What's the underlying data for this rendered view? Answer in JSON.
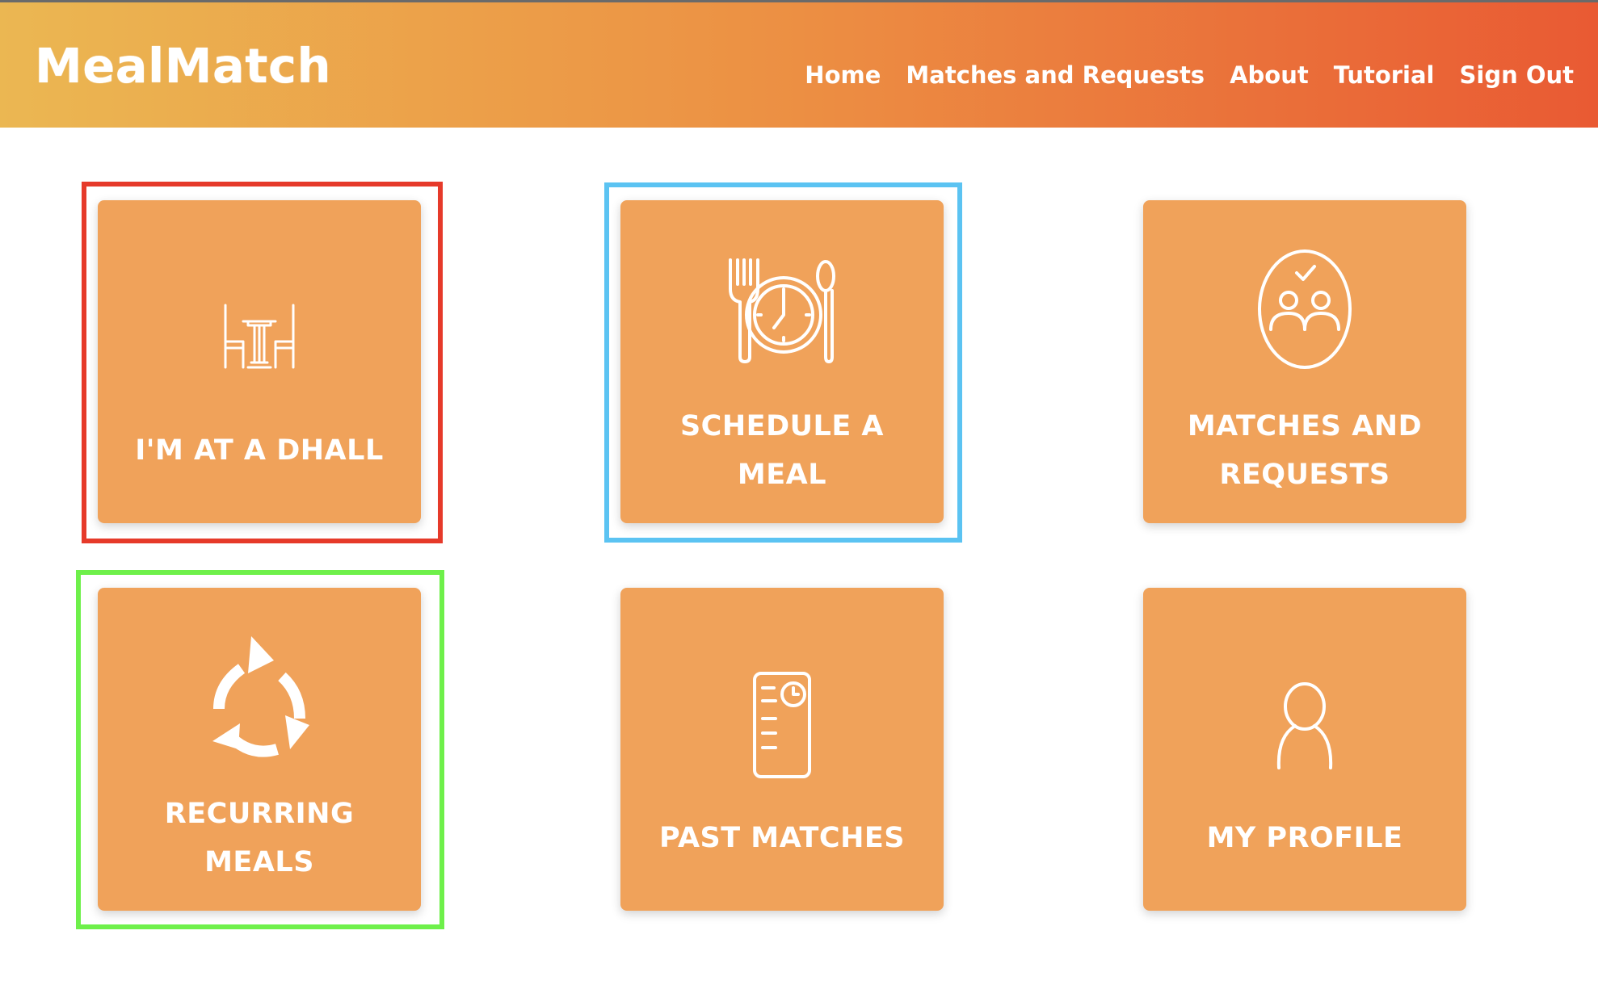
{
  "header": {
    "brand": "MealMatch",
    "nav": [
      "Home",
      "Matches and Requests",
      "About",
      "Tutorial",
      "Sign Out"
    ]
  },
  "tiles": [
    {
      "label": "I'M AT A DHALL",
      "icon": "dining-table-icon"
    },
    {
      "label": "SCHEDULE A MEAL",
      "icon": "meal-clock-icon"
    },
    {
      "label": "MATCHES AND REQUESTS",
      "icon": "people-check-icon"
    },
    {
      "label": "RECURRING MEALS",
      "icon": "recurring-arrows-icon"
    },
    {
      "label": "PAST MATCHES",
      "icon": "history-document-icon"
    },
    {
      "label": "MY PROFILE",
      "icon": "person-icon"
    }
  ],
  "colors": {
    "header_gradient": [
      "#ebb752",
      "#ec8f43",
      "#e95a33"
    ],
    "tile": "#f0a25a",
    "outline_red": "#e63a2a",
    "outline_blue": "#5bc3f2",
    "outline_green": "#6ef04a"
  }
}
